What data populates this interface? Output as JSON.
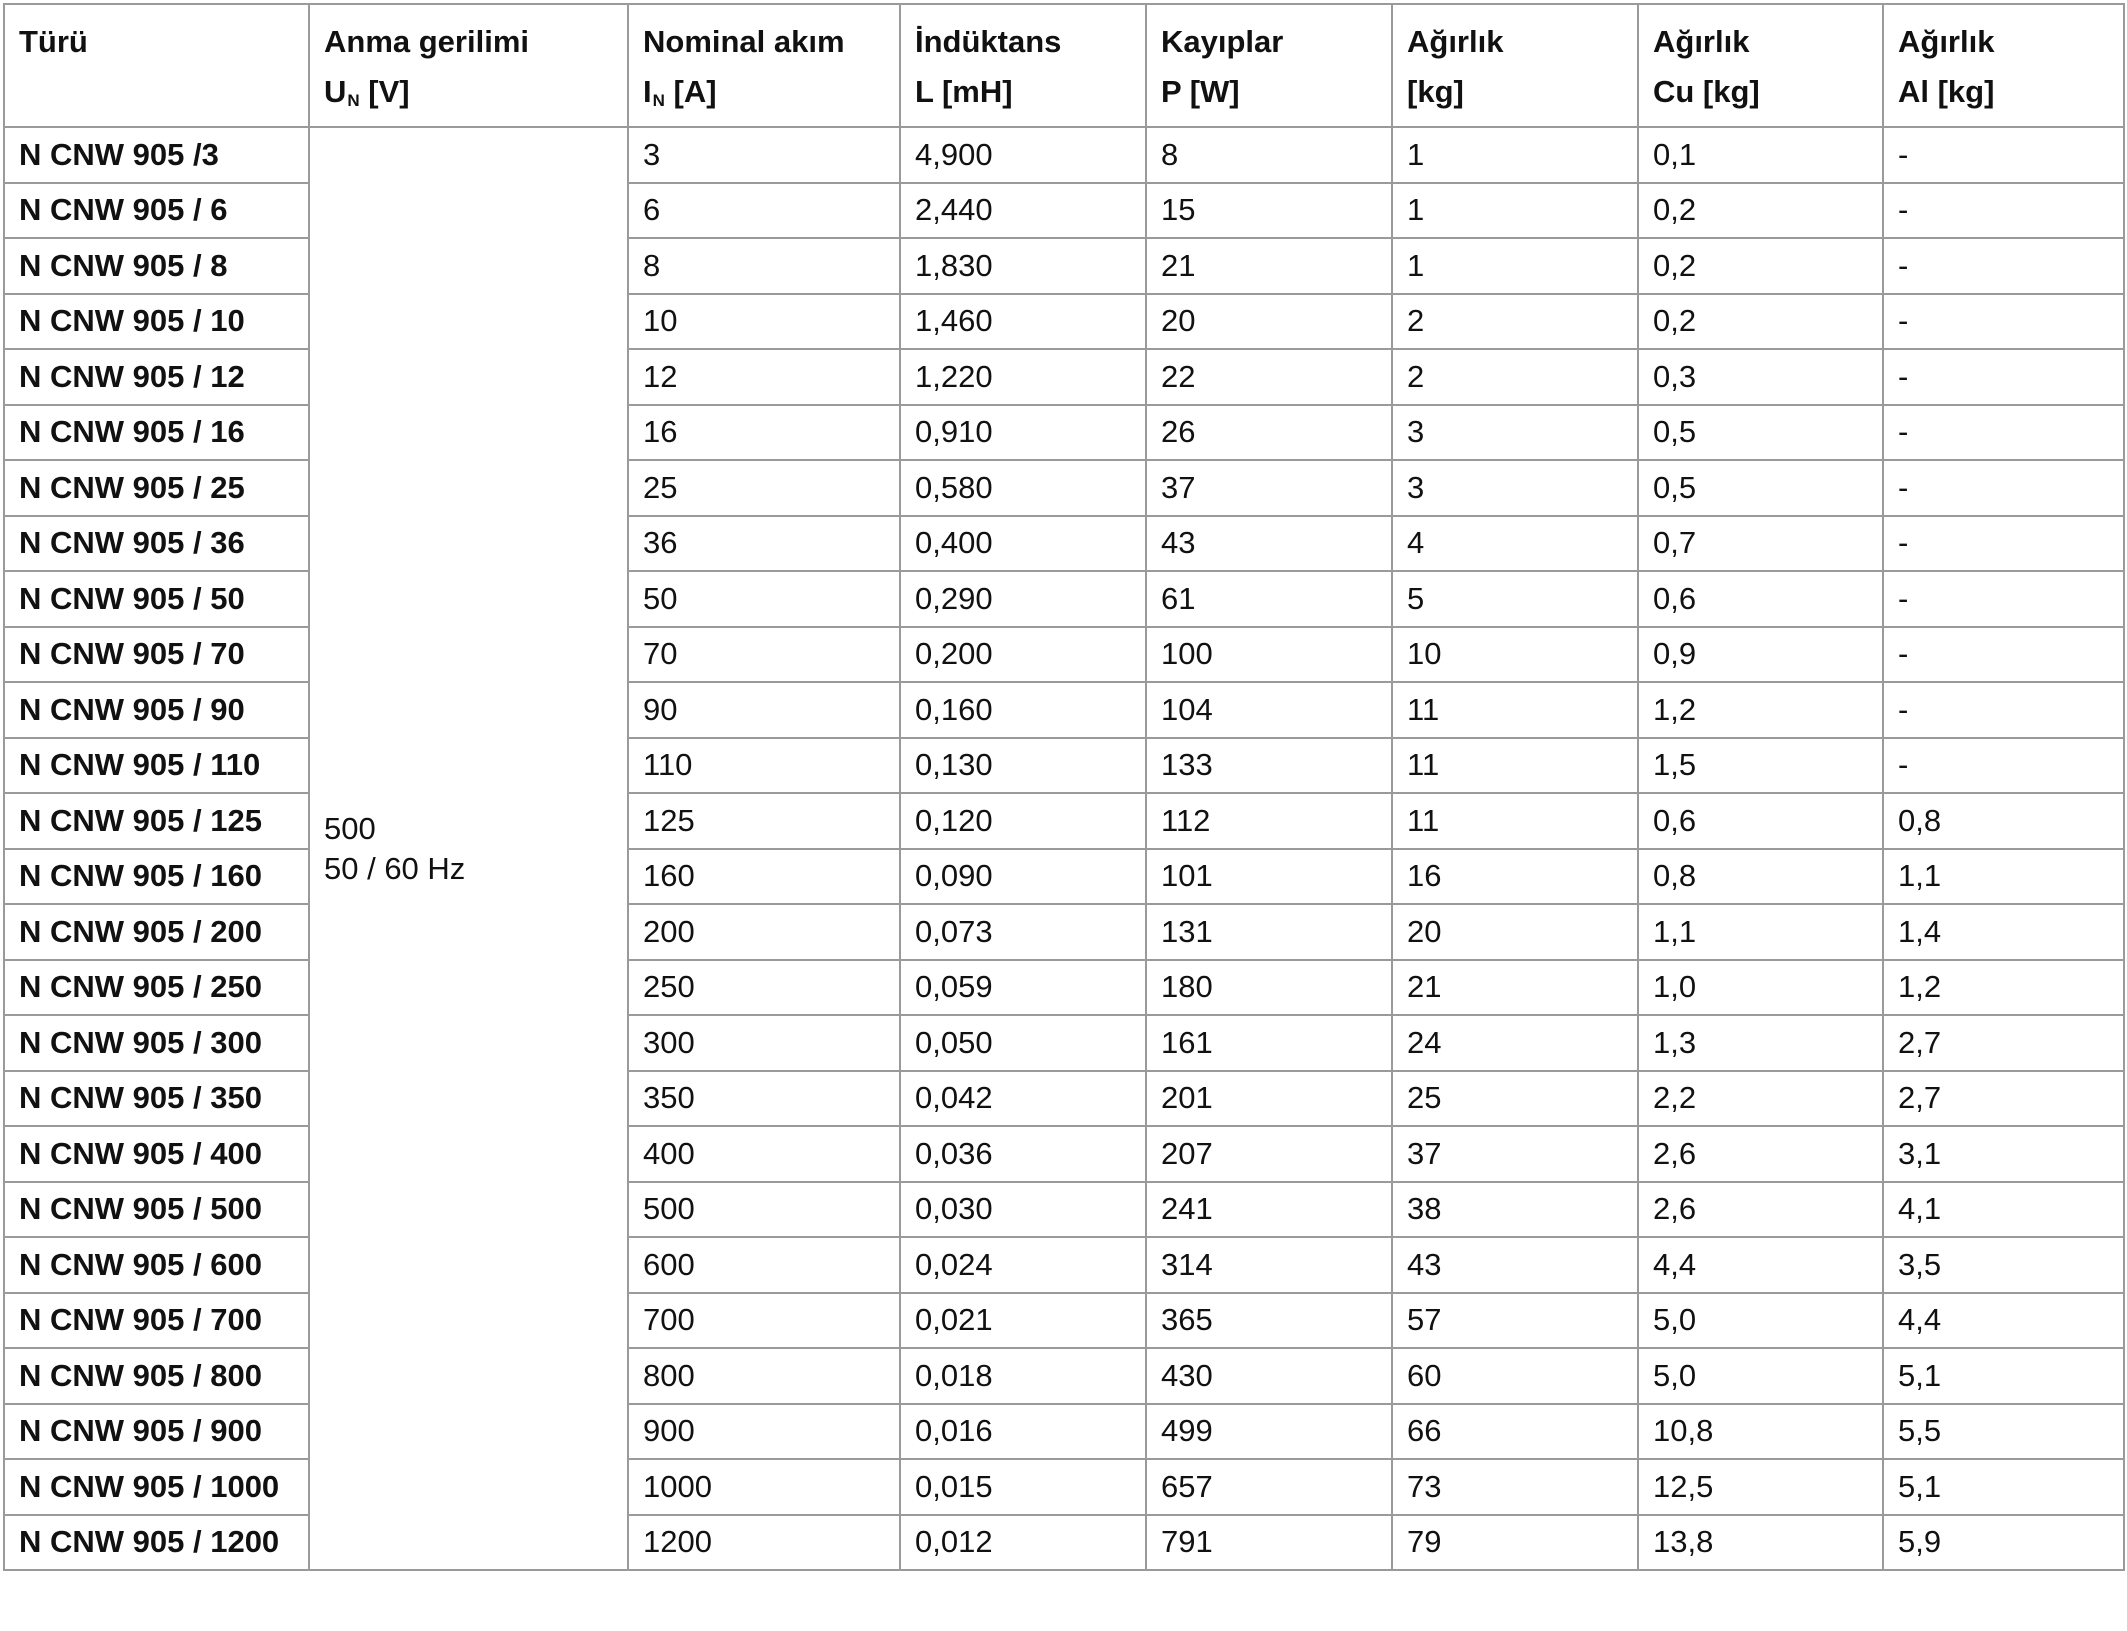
{
  "columns": [
    {
      "line1": "Türü",
      "line2": "",
      "sub": "",
      "unit": ""
    },
    {
      "line1": "Anma gerilimi",
      "line2": "U",
      "sub": "N",
      "unit": " [V]"
    },
    {
      "line1": "Nominal akım",
      "line2": "I",
      "sub": "N",
      "unit": " [A]"
    },
    {
      "line1": "İndüktans",
      "line2": "L [mH]",
      "sub": "",
      "unit": ""
    },
    {
      "line1": "Kayıplar",
      "line2": "P [W]",
      "sub": "",
      "unit": ""
    },
    {
      "line1": "Ağırlık",
      "line2": "[kg]",
      "sub": "",
      "unit": ""
    },
    {
      "line1": "Ağırlık",
      "line2": "Cu [kg]",
      "sub": "",
      "unit": ""
    },
    {
      "line1": "Ağırlık",
      "line2": "Al [kg]",
      "sub": "",
      "unit": ""
    }
  ],
  "voltage": {
    "line1": "500",
    "line2": "50 / 60 Hz"
  },
  "rows": [
    {
      "type": "N CNW 905 /3",
      "current": "3",
      "inductance": "4,900",
      "losses": "8",
      "weight": "1",
      "cu": "0,1",
      "al": "-"
    },
    {
      "type": "N CNW 905 / 6",
      "current": "6",
      "inductance": "2,440",
      "losses": "15",
      "weight": "1",
      "cu": "0,2",
      "al": "-"
    },
    {
      "type": "N CNW 905 / 8",
      "current": "8",
      "inductance": "1,830",
      "losses": "21",
      "weight": "1",
      "cu": "0,2",
      "al": "-"
    },
    {
      "type": "N CNW 905 / 10",
      "current": "10",
      "inductance": "1,460",
      "losses": "20",
      "weight": "2",
      "cu": "0,2",
      "al": "-"
    },
    {
      "type": "N CNW 905 / 12",
      "current": "12",
      "inductance": "1,220",
      "losses": "22",
      "weight": "2",
      "cu": "0,3",
      "al": "-"
    },
    {
      "type": "N CNW 905 / 16",
      "current": "16",
      "inductance": "0,910",
      "losses": "26",
      "weight": "3",
      "cu": "0,5",
      "al": "-"
    },
    {
      "type": "N CNW 905 / 25",
      "current": "25",
      "inductance": "0,580",
      "losses": "37",
      "weight": "3",
      "cu": "0,5",
      "al": "-"
    },
    {
      "type": "N CNW 905 / 36",
      "current": "36",
      "inductance": "0,400",
      "losses": "43",
      "weight": "4",
      "cu": "0,7",
      "al": "-"
    },
    {
      "type": "N CNW 905 / 50",
      "current": "50",
      "inductance": "0,290",
      "losses": "61",
      "weight": "5",
      "cu": "0,6",
      "al": "-"
    },
    {
      "type": "N CNW 905 / 70",
      "current": "70",
      "inductance": "0,200",
      "losses": "100",
      "weight": "10",
      "cu": "0,9",
      "al": "-"
    },
    {
      "type": "N CNW 905 / 90",
      "current": "90",
      "inductance": "0,160",
      "losses": "104",
      "weight": "11",
      "cu": "1,2",
      "al": "-"
    },
    {
      "type": "N CNW 905 / 110",
      "current": "110",
      "inductance": "0,130",
      "losses": "133",
      "weight": "11",
      "cu": "1,5",
      "al": "-"
    },
    {
      "type": "N CNW 905 / 125",
      "current": "125",
      "inductance": "0,120",
      "losses": "112",
      "weight": "11",
      "cu": "0,6",
      "al": "0,8"
    },
    {
      "type": "N CNW 905 / 160",
      "current": "160",
      "inductance": "0,090",
      "losses": "101",
      "weight": "16",
      "cu": "0,8",
      "al": "1,1"
    },
    {
      "type": "N CNW 905 / 200",
      "current": "200",
      "inductance": "0,073",
      "losses": "131",
      "weight": "20",
      "cu": "1,1",
      "al": "1,4"
    },
    {
      "type": "N CNW 905 / 250",
      "current": "250",
      "inductance": "0,059",
      "losses": "180",
      "weight": "21",
      "cu": "1,0",
      "al": "1,2"
    },
    {
      "type": "N CNW 905 / 300",
      "current": "300",
      "inductance": "0,050",
      "losses": "161",
      "weight": "24",
      "cu": "1,3",
      "al": "2,7"
    },
    {
      "type": "N CNW 905 / 350",
      "current": "350",
      "inductance": "0,042",
      "losses": "201",
      "weight": "25",
      "cu": "2,2",
      "al": "2,7"
    },
    {
      "type": "N CNW 905 / 400",
      "current": "400",
      "inductance": "0,036",
      "losses": "207",
      "weight": "37",
      "cu": "2,6",
      "al": "3,1"
    },
    {
      "type": "N CNW 905 / 500",
      "current": "500",
      "inductance": "0,030",
      "losses": "241",
      "weight": "38",
      "cu": "2,6",
      "al": "4,1"
    },
    {
      "type": "N CNW 905 / 600",
      "current": "600",
      "inductance": "0,024",
      "losses": "314",
      "weight": "43",
      "cu": "4,4",
      "al": "3,5"
    },
    {
      "type": "N CNW 905 / 700",
      "current": "700",
      "inductance": "0,021",
      "losses": "365",
      "weight": "57",
      "cu": "5,0",
      "al": "4,4"
    },
    {
      "type": "N CNW 905 / 800",
      "current": "800",
      "inductance": "0,018",
      "losses": "430",
      "weight": "60",
      "cu": "5,0",
      "al": "5,1"
    },
    {
      "type": "N CNW 905 / 900",
      "current": "900",
      "inductance": "0,016",
      "losses": "499",
      "weight": "66",
      "cu": "10,8",
      "al": "5,5"
    },
    {
      "type": "N CNW 905 / 1000",
      "current": "1000",
      "inductance": "0,015",
      "losses": "657",
      "weight": "73",
      "cu": "12,5",
      "al": "5,1"
    },
    {
      "type": "N CNW 905 / 1200",
      "current": "1200",
      "inductance": "0,012",
      "losses": "791",
      "weight": "79",
      "cu": "13,8",
      "al": "5,9"
    }
  ]
}
